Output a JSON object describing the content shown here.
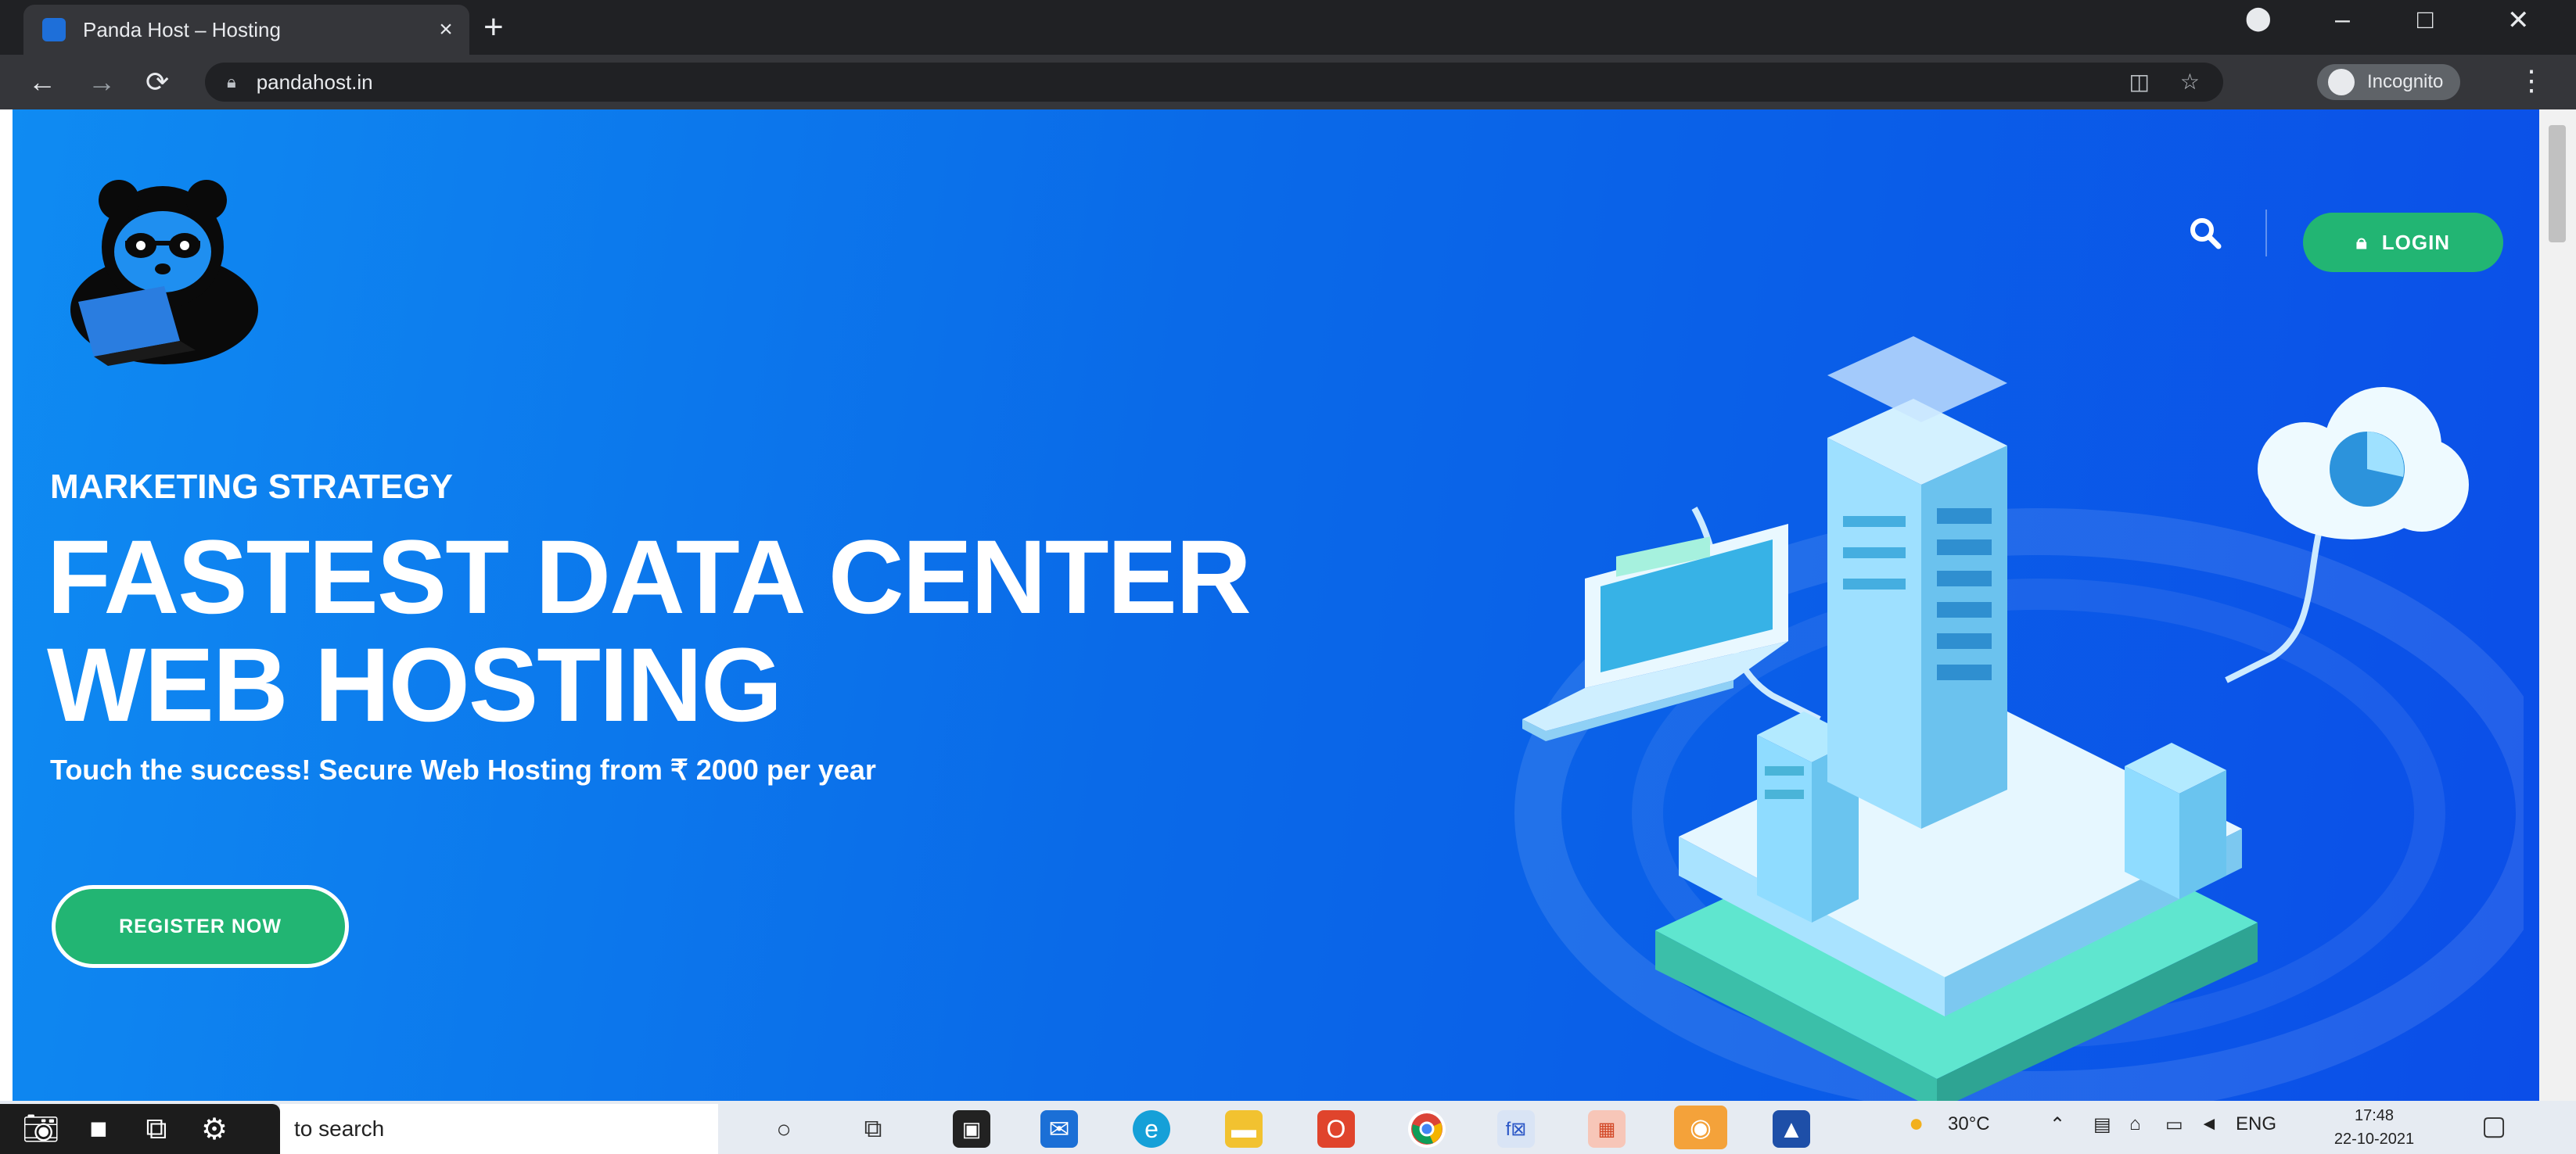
{
  "browser": {
    "tab_title": "Panda Host – Hosting",
    "tab_close": "×",
    "new_tab": "+",
    "url": "pandahost.in",
    "profile_label": "Incognito",
    "window_controls": [
      "–",
      "□",
      "✕"
    ]
  },
  "site": {
    "nav": {
      "login_label": "LOGIN"
    },
    "hero": {
      "eyebrow": "MARKETING STRATEGY",
      "headline_line1": "FASTEST DATA CENTER",
      "headline_line2": "WEB HOSTING",
      "subtext": "Touch the success! Secure Web Hosting from ₹ 2000 per year",
      "register_label": "REGISTER NOW"
    }
  },
  "taskbar": {
    "search_placeholder": "to search",
    "weather": "30°C",
    "language": "ENG",
    "time": "17:48",
    "date": "22-10-2021"
  },
  "colors": {
    "hero_blue": "#0b5ee8",
    "accent_green": "#22b573",
    "chrome_dark": "#202124"
  }
}
